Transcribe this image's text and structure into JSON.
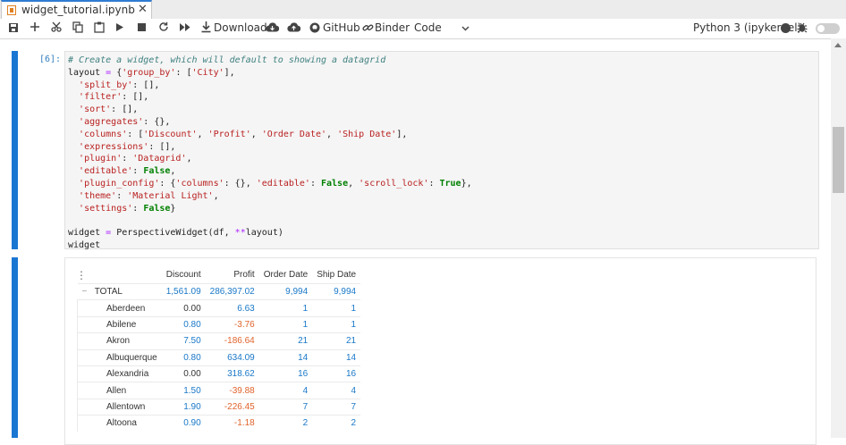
{
  "tab": {
    "title": "widget_tutorial.ipynb",
    "close": "✕"
  },
  "toolbar": {
    "download_label": "Download",
    "github_label": "GitHub",
    "binder_label": "Binder",
    "cell_type": "Code",
    "kernel_name": "Python 3 (ipykernel)"
  },
  "cell": {
    "prompt": "[6]:",
    "code_lines": [
      "# Create a widget, which will default to showing a datagrid",
      "layout = {'group_by': ['City'],",
      "  'split_by': [],",
      "  'filter': [],",
      "  'sort': [],",
      "  'aggregates': {},",
      "  'columns': ['Discount', 'Profit', 'Order Date', 'Ship Date'],",
      "  'expressions': [],",
      "  'plugin': 'Datagrid',",
      "  'editable': False,",
      "  'plugin_config': {'columns': {}, 'editable': False, 'scroll_lock': True},",
      "  'theme': 'Material Light',",
      "  'settings': False}",
      "",
      "widget = PerspectiveWidget(df, **layout)",
      "widget"
    ]
  },
  "grid": {
    "menu_icon": "⋮",
    "columns": [
      "Discount",
      "Profit",
      "Order Date",
      "Ship Date"
    ],
    "total": {
      "toggle": "−",
      "label": "TOTAL",
      "values": [
        "1,561.09",
        "286,397.02",
        "9,994",
        "9,994"
      ]
    },
    "rows": [
      {
        "city": "Aberdeen",
        "values": [
          "0.00",
          "6.63",
          "1",
          "1"
        ]
      },
      {
        "city": "Abilene",
        "values": [
          "0.80",
          "-3.76",
          "1",
          "1"
        ]
      },
      {
        "city": "Akron",
        "values": [
          "7.50",
          "-186.64",
          "21",
          "21"
        ]
      },
      {
        "city": "Albuquerque",
        "values": [
          "0.80",
          "634.09",
          "14",
          "14"
        ]
      },
      {
        "city": "Alexandria",
        "values": [
          "0.00",
          "318.62",
          "16",
          "16"
        ]
      },
      {
        "city": "Allen",
        "values": [
          "1.50",
          "-39.88",
          "4",
          "4"
        ]
      },
      {
        "city": "Allentown",
        "values": [
          "1.90",
          "-226.45",
          "7",
          "7"
        ]
      },
      {
        "city": "Altoona",
        "values": [
          "0.90",
          "-1.18",
          "2",
          "2"
        ]
      }
    ]
  },
  "colors": {
    "accent": "#1976d2",
    "positive": "#1978c8",
    "negative": "#e0642c"
  }
}
